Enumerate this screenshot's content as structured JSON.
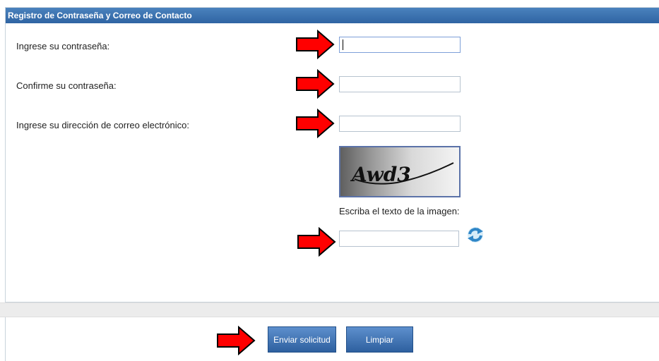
{
  "header": {
    "title": "Registro de Contraseña y Correo de Contacto"
  },
  "form": {
    "password_label": "Ingrese su contraseña:",
    "password_value": "",
    "confirm_label": "Confirme su contraseña:",
    "confirm_value": "",
    "email_label": "Ingrese su dirección de correo electrónico:",
    "email_value": "",
    "captcha_image_text": "Awd3",
    "captcha_prompt": "Escriba el texto de la imagen:",
    "captcha_value": ""
  },
  "icons": {
    "refresh": "refresh-icon",
    "arrow": "red-arrow-icon"
  },
  "buttons": {
    "submit_label": "Enviar solicitud",
    "clear_label": "Limpiar"
  },
  "colors": {
    "header_bg": "#3a71b0",
    "button_bg": "#3d6fb0",
    "arrow_red": "#ff0000"
  }
}
